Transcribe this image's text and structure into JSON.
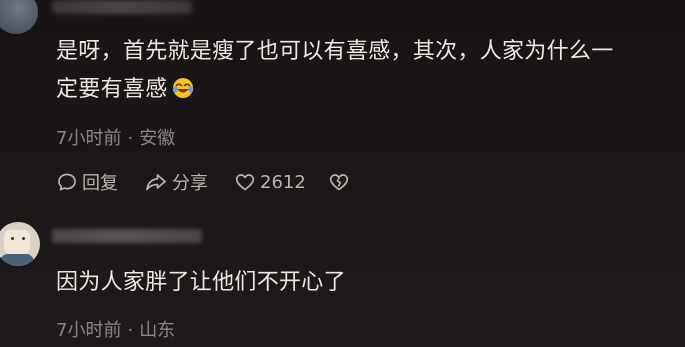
{
  "comments": [
    {
      "username": "",
      "text_line1": "是呀，首先就是瘦了也可以有喜感，其次，人家为什么一",
      "text_line2": "定要有喜感",
      "emoji": "face-with-tears-of-joy",
      "time": "7小时前",
      "location": "安徽",
      "actions": {
        "reply_label": "回复",
        "share_label": "分享",
        "like_count": "2612"
      }
    },
    {
      "username": "",
      "text_line1": "因为人家胖了让他们不开心了",
      "time": "7小时前",
      "location": "山东"
    }
  ],
  "colors": {
    "background": "#1a1616",
    "text": "#ece8e6",
    "meta": "#8a8584",
    "action": "#b9b4b2"
  }
}
